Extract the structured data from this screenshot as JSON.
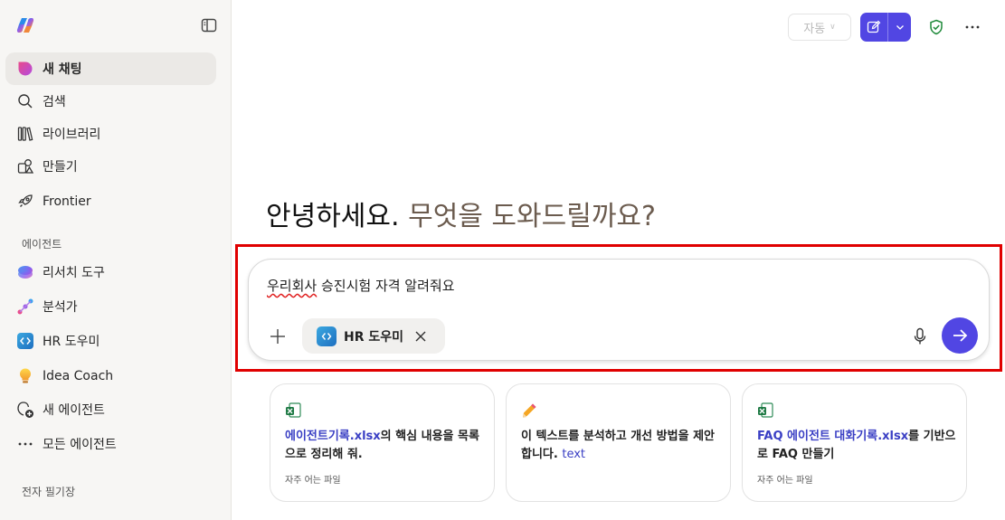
{
  "sidebar": {
    "nav": [
      {
        "label": "새 채팅"
      },
      {
        "label": "검색"
      },
      {
        "label": "라이브러리"
      },
      {
        "label": "만들기"
      },
      {
        "label": "Frontier"
      }
    ],
    "agents_section": "에이전트",
    "agents": [
      {
        "label": "리서치 도구"
      },
      {
        "label": "분석가"
      },
      {
        "label": "HR 도우미"
      },
      {
        "label": "Idea Coach"
      },
      {
        "label": "새 에이전트"
      },
      {
        "label": "모든 에이전트"
      }
    ],
    "notes_section": "전자 필기장"
  },
  "header": {
    "mode_label": "자동"
  },
  "main": {
    "greeting_part1": "안녕하세요.",
    "greeting_part2": "무엇을 도와드릴까요?",
    "composer": {
      "prompt_prefix": "우리회사",
      "prompt_rest": " 승진시험 자격 알려줘요",
      "agent_chip": "HR 도우미"
    },
    "cards": [
      {
        "link": "에이전트기록.xlsx",
        "text": "의 핵심 내용을 목록으로 정리해 줘.",
        "sub": "자주 어는 파일"
      },
      {
        "text": "이 텍스트를 분석하고 개선 방법을 제안합니다.",
        "accent": "text"
      },
      {
        "link": "FAQ 에이전트 대화기록.xlsx",
        "text": "를 기반으로 FAQ 만들기",
        "sub": "자주 어는 파일"
      }
    ]
  },
  "colors": {
    "accent": "#5146e3",
    "highlight": "#e00000",
    "link": "#3a3fc4"
  }
}
